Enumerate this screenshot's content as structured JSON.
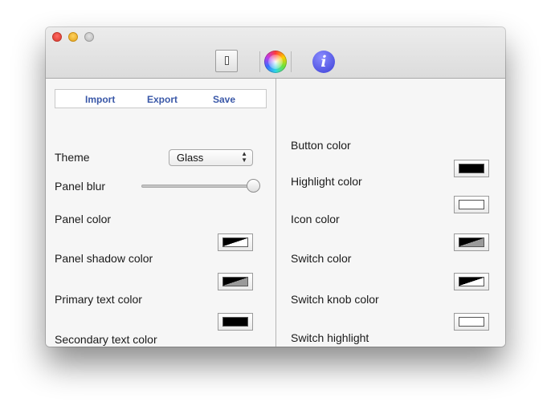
{
  "window": {
    "toolbar": {
      "items": [
        {
          "name": "switch-icon"
        },
        {
          "name": "color-wheel-icon"
        },
        {
          "name": "info-icon",
          "glyph": "i"
        }
      ]
    }
  },
  "left_panel": {
    "import_label": "Import",
    "export_label": "Export",
    "save_label": "Save",
    "theme_label": "Theme",
    "theme_value": "Glass",
    "panel_blur_label": "Panel blur",
    "panel_blur_value": 1.0,
    "rows": [
      {
        "label": "Panel color",
        "swatch": "half-black-white"
      },
      {
        "label": "Panel shadow color",
        "swatch": "half-black-gray"
      },
      {
        "label": "Primary text color",
        "swatch": "black"
      },
      {
        "label": "Secondary text color",
        "swatch": "black"
      }
    ]
  },
  "right_panel": {
    "rows": [
      {
        "label": "Button color",
        "swatch": "black"
      },
      {
        "label": "Highlight color",
        "swatch": "white"
      },
      {
        "label": "Icon color",
        "swatch": "half-black-gray"
      },
      {
        "label": "Switch color",
        "swatch": "half-black-white"
      },
      {
        "label": "Switch knob color",
        "swatch": "white"
      },
      {
        "label": "Switch highlight",
        "swatch": "white"
      }
    ]
  },
  "colors": {
    "link": "#3a58a8",
    "black": "#000000",
    "white": "#ffffff",
    "gray": "#9a9a9a"
  }
}
